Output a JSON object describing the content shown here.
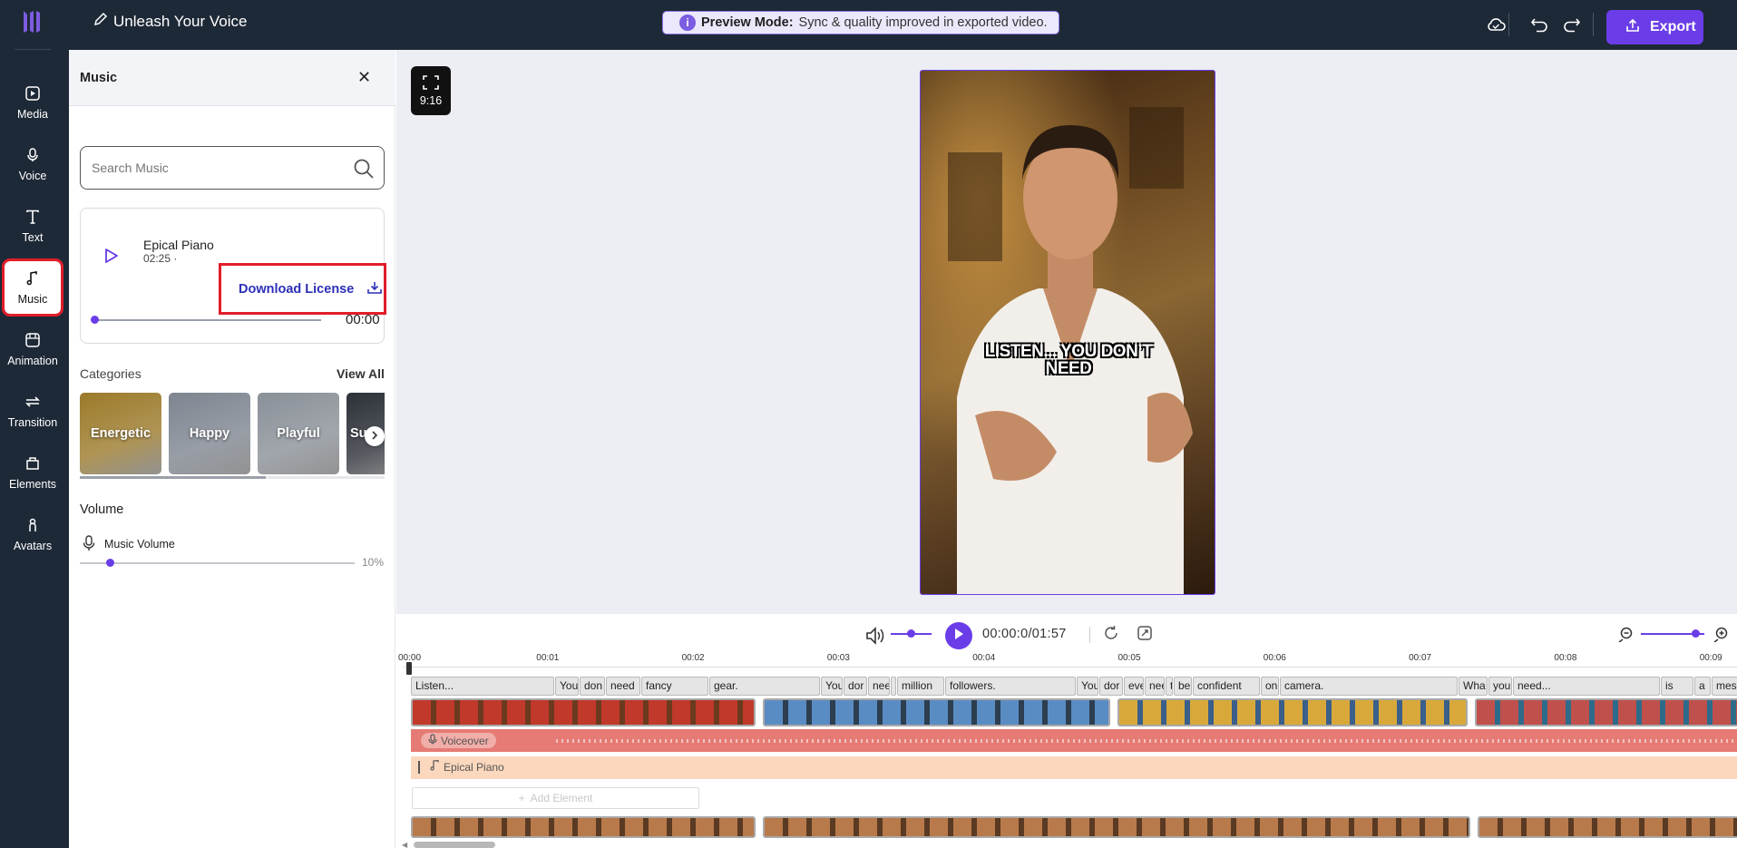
{
  "header": {
    "project_title": "Unleash Your Voice",
    "banner_bold": "Preview Mode:",
    "banner_text": "Sync & quality improved in exported video.",
    "export_label": "Export"
  },
  "rail": {
    "items": [
      {
        "label": "Media",
        "icon": "media-icon"
      },
      {
        "label": "Voice",
        "icon": "microphone-icon"
      },
      {
        "label": "Text",
        "icon": "text-icon"
      },
      {
        "label": "Music",
        "icon": "music-note-icon"
      },
      {
        "label": "Animation",
        "icon": "animation-icon"
      },
      {
        "label": "Transition",
        "icon": "transition-icon"
      },
      {
        "label": "Elements",
        "icon": "elements-icon"
      },
      {
        "label": "Avatars",
        "icon": "avatar-icon"
      }
    ],
    "active": "Music"
  },
  "panel": {
    "title": "Music",
    "search_placeholder": "Search Music",
    "track": {
      "name": "Epical Piano",
      "meta": "02:25 ·",
      "download_label": "Download License",
      "time": "00:00"
    },
    "categories_label": "Categories",
    "view_all_label": "View All",
    "categories": [
      {
        "label": "Energetic",
        "color": "#9b7a2a"
      },
      {
        "label": "Happy",
        "color": "#7e8590"
      },
      {
        "label": "Playful",
        "color": "#8a9098"
      },
      {
        "label": "Su",
        "color": "#2c3038"
      }
    ],
    "volume_label": "Volume",
    "music_volume_label": "Music Volume",
    "volume_pct": "10%",
    "volume_value": 0.1
  },
  "stage": {
    "ratio": "9:16",
    "caption_line1": "LISTEN... YOU DON’T",
    "caption_line2": "NEED"
  },
  "playback": {
    "time": "00:00:0/01:57"
  },
  "timeline": {
    "ticks": [
      "00:00",
      "00:01",
      "00:02",
      "00:03",
      "00:04",
      "00:05",
      "00:06",
      "00:07",
      "00:08",
      "00:09"
    ],
    "words": [
      "Listen...",
      "You",
      "don",
      "need",
      "fancy",
      "gear.",
      "You",
      "dor",
      "nee",
      "c",
      "million",
      "followers.",
      "You",
      "dor",
      "eve",
      "nee",
      "t",
      "be",
      "confident",
      "on",
      "camera.",
      "Wha",
      "you",
      "need...",
      "is",
      "a",
      "message"
    ],
    "voiceover_label": "Voiceover",
    "music_label": "Epical Piano",
    "add_element_label": "Add Element"
  },
  "colors": {
    "accent": "#6a3de8",
    "dark": "#1e2937",
    "highlight": "#e11d2a",
    "voice_track": "#e57b74",
    "music_track": "#fbd7bd"
  }
}
